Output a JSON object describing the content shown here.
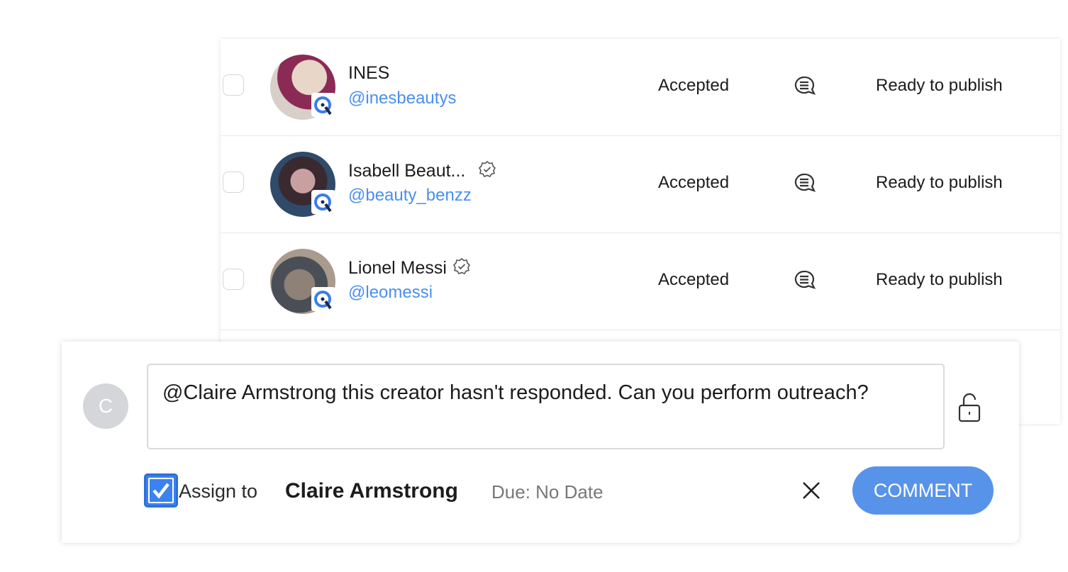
{
  "rows": [
    {
      "name": "INES",
      "handle": "@inesbeautys",
      "verified": false,
      "status": "Accepted",
      "stage": "Ready to publish",
      "avatar_colors": [
        "#e8d6c8",
        "#8a2a55"
      ]
    },
    {
      "name": "Isabell Beaut...",
      "handle": "@beauty_benzz",
      "verified": true,
      "status": "Accepted",
      "stage": "Ready to publish",
      "avatar_colors": [
        "#2f4a6b",
        "#c9a0a0"
      ]
    },
    {
      "name": "Lionel Messi",
      "handle": "@leomessi",
      "verified": true,
      "status": "Accepted",
      "stage": "Ready to publish",
      "avatar_colors": [
        "#a99b8d",
        "#4a4f57"
      ]
    }
  ],
  "comment": {
    "avatar_initial": "C",
    "mention": "@Claire Armstrong",
    "text": " this creator hasn't responded. Can you perform outreach?",
    "assign_label": "Assign to",
    "assign_checked": true,
    "assignee": "Claire Armstrong",
    "due": "Due: No Date",
    "button_label": "COMMENT"
  },
  "colors": {
    "accent": "#5893ea",
    "link": "#4a8ff0",
    "checkbox": "#3b82f0"
  }
}
